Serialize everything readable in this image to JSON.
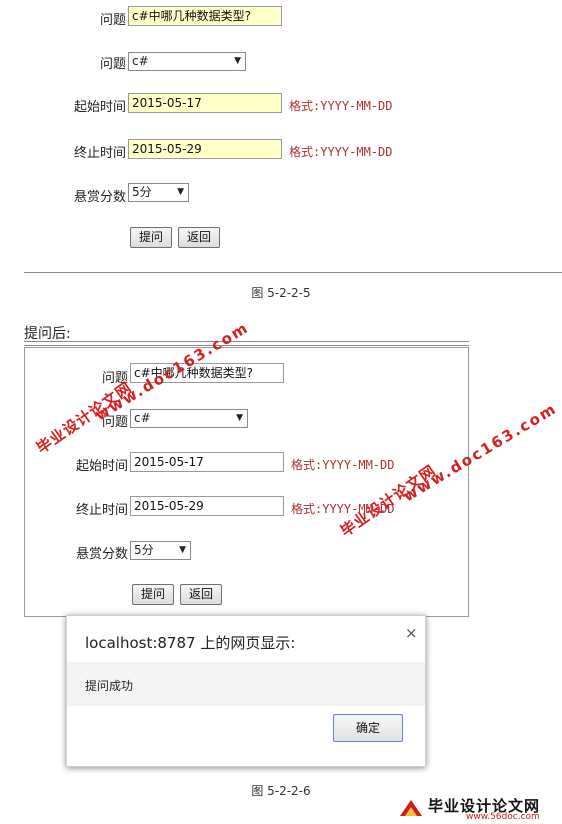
{
  "form1": {
    "question_label": "问题",
    "question_value": "c#中哪几种数据类型?",
    "category_label": "问题",
    "category_value": "c#",
    "start_label": "起始时间",
    "start_value": "2015-05-17",
    "end_label": "终止时间",
    "end_value": "2015-05-29",
    "format_hint": "格式:YYYY-MM-DD",
    "reward_label": "悬赏分数",
    "reward_value": "5分",
    "submit_label": "提问",
    "back_label": "返回"
  },
  "caption1": "图 5-2-2-5",
  "section_heading": "提问后:",
  "form2": {
    "question_label": "问题",
    "question_value": "c#中哪几种数据类型?",
    "category_label": "问题",
    "category_value": "c#",
    "start_label": "起始时间",
    "start_value": "2015-05-17",
    "end_label": "终止时间",
    "end_value": "2015-05-29",
    "format_hint": "格式:YYYY-MM-DD",
    "reward_label": "悬赏分数",
    "reward_value": "5分",
    "submit_label": "提问",
    "back_label": "返回"
  },
  "dialog": {
    "title": "localhost:8787 上的网页显示:",
    "message": "提问成功",
    "ok_label": "确定",
    "close_glyph": "×"
  },
  "caption2": "图 5-2-2-6",
  "watermarks": {
    "site_url": "www.doc163.com",
    "site_name": "毕业设计论文网",
    "footer_name": "毕业设计论文网",
    "footer_url": "www.56doc.com"
  },
  "colors": {
    "watermark": "#d42020",
    "highlight": "#ffffc8",
    "format_text": "#b03030"
  }
}
